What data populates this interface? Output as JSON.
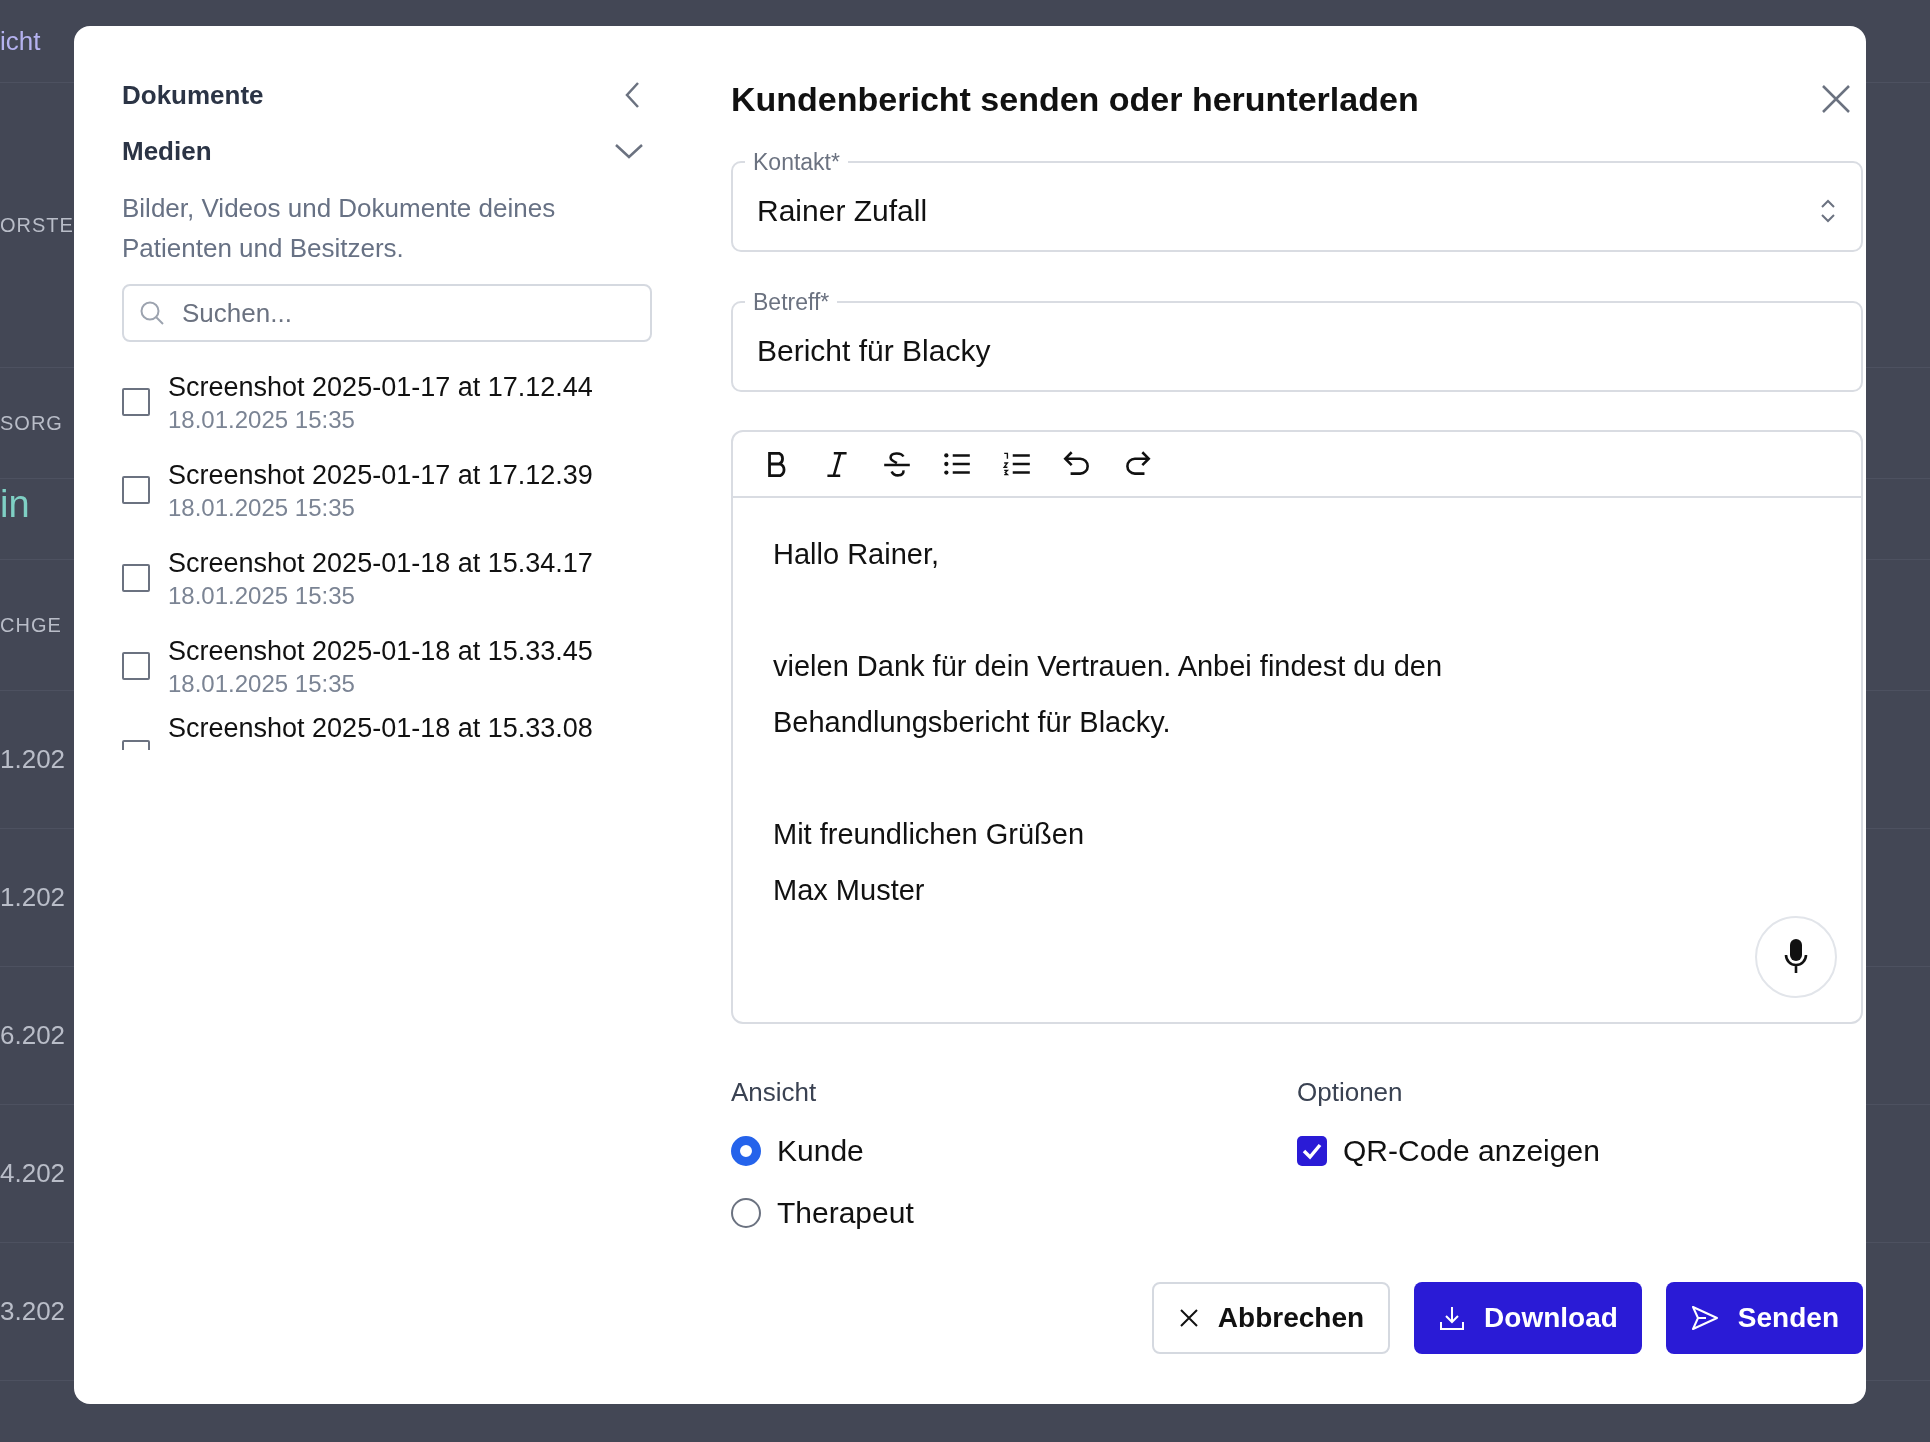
{
  "backdrop": [
    {
      "kind": "link",
      "text": "icht"
    },
    {
      "kind": "header",
      "text": "ORSTE"
    },
    {
      "kind": "header",
      "text": "SORG"
    },
    {
      "kind": "value",
      "text": "in"
    },
    {
      "kind": "header",
      "text": "CHGE"
    },
    {
      "kind": "cell",
      "text": "1.202"
    },
    {
      "kind": "cell",
      "text": "1.202"
    },
    {
      "kind": "cell",
      "text": "6.202"
    },
    {
      "kind": "cell",
      "text": "4.202"
    },
    {
      "kind": "cell",
      "text": "3.202"
    }
  ],
  "sidebar": {
    "title": "Dokumente",
    "section": "Medien",
    "expanded": true,
    "description": "Bilder, Videos und Dokumente deines Patienten und Besitzers.",
    "search": {
      "placeholder": "Suchen..."
    },
    "files": [
      {
        "name": "Screenshot 2025-01-17 at 17.12.44",
        "date": "18.01.2025 15:35",
        "checked": false
      },
      {
        "name": "Screenshot 2025-01-17 at 17.12.39",
        "date": "18.01.2025 15:35",
        "checked": false
      },
      {
        "name": "Screenshot 2025-01-18 at 15.34.17",
        "date": "18.01.2025 15:35",
        "checked": false
      },
      {
        "name": "Screenshot 2025-01-18 at 15.33.45",
        "date": "18.01.2025 15:35",
        "checked": false
      },
      {
        "name": "Screenshot 2025-01-18 at 15.33.08",
        "checked": false
      }
    ]
  },
  "dialog": {
    "title": "Kundenbericht senden oder herunterladen",
    "contact": {
      "label": "Kontakt*",
      "value": "Rainer Zufall"
    },
    "subject": {
      "label": "Betreff*",
      "value": "Bericht für Blacky"
    },
    "toolbar": [
      {
        "kind": "bold"
      },
      {
        "kind": "italic"
      },
      {
        "kind": "strike"
      },
      {
        "kind": "bullets"
      },
      {
        "kind": "numbers"
      },
      {
        "kind": "undo"
      },
      {
        "kind": "redo"
      }
    ],
    "body": [
      [
        "Hallo Rainer,"
      ],
      [
        "vielen Dank für dein Vertrauen. Anbei findest du den",
        "Behandlungsbericht für Blacky."
      ],
      [
        "Mit freundlichen Grüßen",
        "Max Muster"
      ]
    ],
    "view": {
      "label": "Ansicht",
      "options": [
        {
          "label": "Kunde",
          "selected": true
        },
        {
          "label": "Therapeut",
          "selected": false
        }
      ]
    },
    "options": {
      "label": "Optionen",
      "items": [
        {
          "label": "QR-Code anzeigen",
          "checked": true
        }
      ]
    },
    "buttons": [
      {
        "kind": "cancel",
        "label": "Abbrechen"
      },
      {
        "kind": "download",
        "label": "Download"
      },
      {
        "kind": "send",
        "label": "Senden"
      }
    ]
  }
}
